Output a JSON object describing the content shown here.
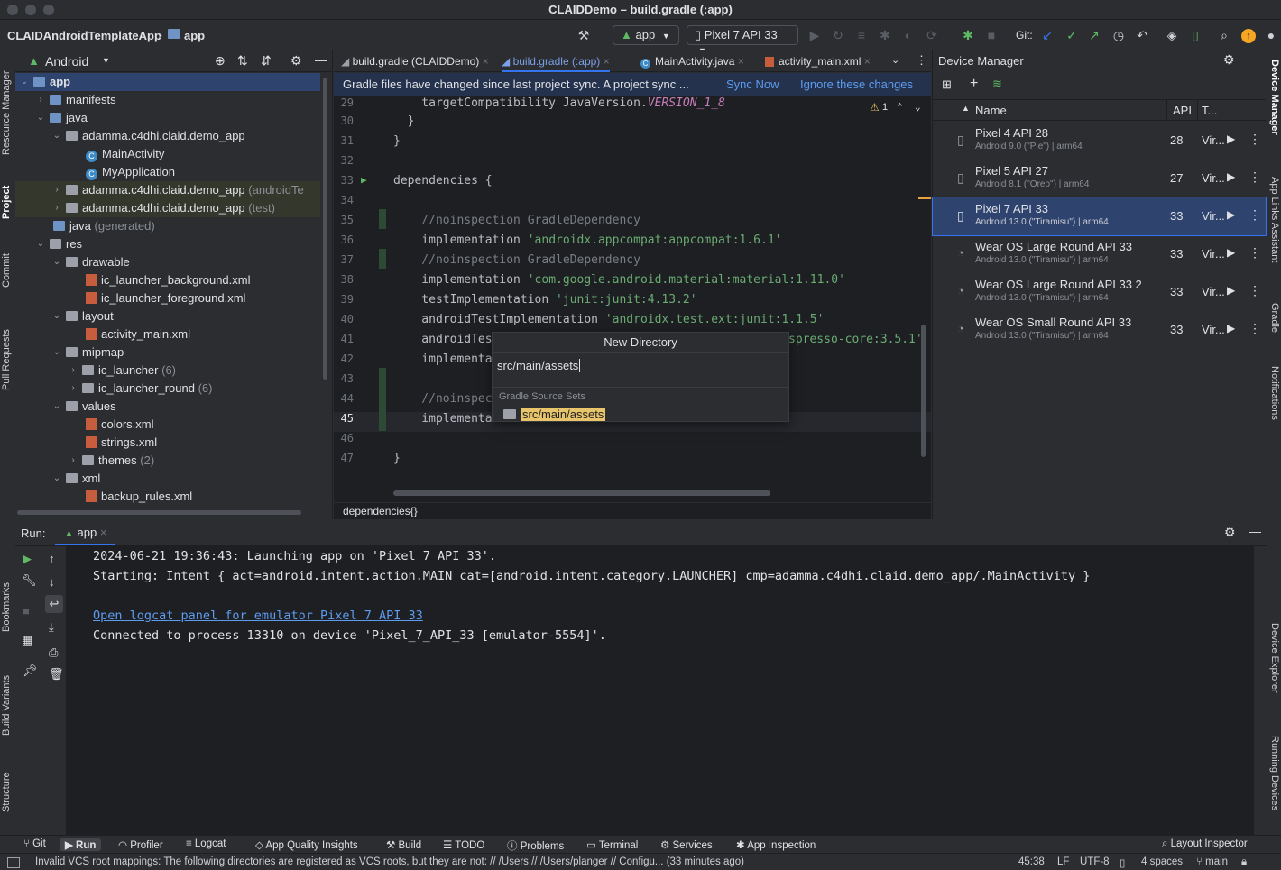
{
  "window": {
    "title": "CLAIDDemo – build.gradle (:app)"
  },
  "toolbar": {
    "project_name": "CLAIDAndroidTemplateApp",
    "module": "app",
    "run_config": "app",
    "device": "Pixel 7 API 33",
    "git_label": "Git:"
  },
  "project": {
    "view_mode": "Android",
    "tree": [
      {
        "label": "app",
        "extra": ""
      },
      {
        "label": "manifests",
        "extra": ""
      },
      {
        "label": "java",
        "extra": ""
      },
      {
        "label": "adamma.c4dhi.claid.demo_app",
        "extra": ""
      },
      {
        "label": "MainActivity",
        "extra": ""
      },
      {
        "label": "MyApplication",
        "extra": ""
      },
      {
        "label": "adamma.c4dhi.claid.demo_app",
        "extra": "(androidTe"
      },
      {
        "label": "adamma.c4dhi.claid.demo_app",
        "extra": "(test)"
      },
      {
        "label": "java",
        "extra": "(generated)"
      },
      {
        "label": "res",
        "extra": ""
      },
      {
        "label": "drawable",
        "extra": ""
      },
      {
        "label": "ic_launcher_background.xml",
        "extra": ""
      },
      {
        "label": "ic_launcher_foreground.xml",
        "extra": ""
      },
      {
        "label": "layout",
        "extra": ""
      },
      {
        "label": "activity_main.xml",
        "extra": ""
      },
      {
        "label": "mipmap",
        "extra": ""
      },
      {
        "label": "ic_launcher",
        "extra": "(6)"
      },
      {
        "label": "ic_launcher_round",
        "extra": "(6)"
      },
      {
        "label": "values",
        "extra": ""
      },
      {
        "label": "colors.xml",
        "extra": ""
      },
      {
        "label": "strings.xml",
        "extra": ""
      },
      {
        "label": "themes",
        "extra": "(2)"
      },
      {
        "label": "xml",
        "extra": ""
      },
      {
        "label": "backup_rules.xml",
        "extra": ""
      }
    ]
  },
  "editor": {
    "tabs": [
      {
        "label": "build.gradle (CLAIDDemo)"
      },
      {
        "label": "build.gradle (:app)"
      },
      {
        "label": "MainActivity.java"
      },
      {
        "label": "activity_main.xml"
      }
    ],
    "banner": {
      "message": "Gradle files have changed since last project sync. A project sync ...",
      "sync_now": "Sync Now",
      "ignore": "Ignore these changes"
    },
    "warning_count": "1",
    "line_numbers": [
      "29",
      "30",
      "31",
      "32",
      "33",
      "34",
      "35",
      "36",
      "37",
      "38",
      "39",
      "40",
      "41",
      "42",
      "43",
      "44",
      "45",
      "46",
      "47"
    ],
    "lines": {
      "l29a": "    targetCompatibility JavaVersion.",
      "l29b": "VERSION_1_8",
      "l30": "  }",
      "l31": "}",
      "l33": "dependencies {",
      "l35": "    //noinspection GradleDependency",
      "l36a": "    implementation ",
      "l36b": "'androidx.appcompat:appcompat:1.6.1'",
      "l37": "    //noinspection GradleDependency",
      "l38a": "    implementation ",
      "l38b": "'com.google.android.material:material:1.11.0'",
      "l39a": "    testImplementation ",
      "l39b": "'junit:junit:4.13.2'",
      "l40a": "    androidTestImplementation ",
      "l40b": "'androidx.test.ext:junit:1.1.5'",
      "l41a": "    androidTes",
      "l41b": "spresso-core:3.5.1'",
      "l42": "    implementa",
      "l44": "    //noinspec",
      "l45": "    implementa",
      "l47": "}"
    },
    "breadcrumb": "dependencies{}"
  },
  "popup": {
    "title": "New Directory",
    "input_value": "src/main/assets",
    "section": "Gradle Source Sets",
    "suggestion": "src/main/assets"
  },
  "device_manager": {
    "title": "Device Manager",
    "col_name": "Name",
    "col_api": "API",
    "col_type": "T...",
    "devices": [
      {
        "name": "Pixel 4 API 28",
        "sub": "Android 9.0 (\"Pie\") | arm64",
        "api": "28",
        "type": "Vir..."
      },
      {
        "name": "Pixel 5 API 27",
        "sub": "Android 8.1 (\"Oreo\") | arm64",
        "api": "27",
        "type": "Vir..."
      },
      {
        "name": "Pixel 7 API 33",
        "sub": "Android 13.0 (\"Tiramisu\") | arm64",
        "api": "33",
        "type": "Vir..."
      },
      {
        "name": "Wear OS Large Round API 33",
        "sub": "Android 13.0 (\"Tiramisu\") | arm64",
        "api": "33",
        "type": "Vir..."
      },
      {
        "name": "Wear OS Large Round API 33 2",
        "sub": "Android 13.0 (\"Tiramisu\") | arm64",
        "api": "33",
        "type": "Vir..."
      },
      {
        "name": "Wear OS Small Round API 33",
        "sub": "Android 13.0 (\"Tiramisu\") | arm64",
        "api": "33",
        "type": "Vir..."
      }
    ]
  },
  "left_strip": [
    "Resource Manager",
    "Project",
    "Commit",
    "Pull Requests",
    "Bookmarks",
    "Build Variants",
    "Structure"
  ],
  "right_strip": [
    "Device Manager",
    "App Links Assistant",
    "Gradle",
    "Notifications",
    "Device Explorer",
    "Running Devices"
  ],
  "run": {
    "label": "Run:",
    "tab": "app",
    "output": [
      "2024-06-21 19:36:43: Launching app on 'Pixel 7 API 33'.",
      "Starting: Intent { act=android.intent.action.MAIN cat=[android.intent.category.LAUNCHER] cmp=adamma.c4dhi.claid.demo_app/.MainActivity }",
      "Open logcat panel for emulator Pixel 7 API 33",
      "Connected to process 13310 on device 'Pixel_7_API_33 [emulator-5554]'."
    ]
  },
  "bottom_tools": [
    "Git",
    "Run",
    "Profiler",
    "Logcat",
    "App Quality Insights",
    "Build",
    "TODO",
    "Problems",
    "Terminal",
    "Services",
    "App Inspection",
    "Layout Inspector"
  ],
  "status": {
    "message": "Invalid VCS root mappings: The following directories are registered as VCS roots, but they are not: // /Users // /Users/planger // Configu... (33 minutes ago)",
    "position": "45:38",
    "line_sep": "LF",
    "encoding": "UTF-8",
    "indent": "4 spaces",
    "branch": "main"
  },
  "colors": {
    "accent": "#3574f0",
    "selection": "#2e436e",
    "highlight": "#e8c46a"
  }
}
